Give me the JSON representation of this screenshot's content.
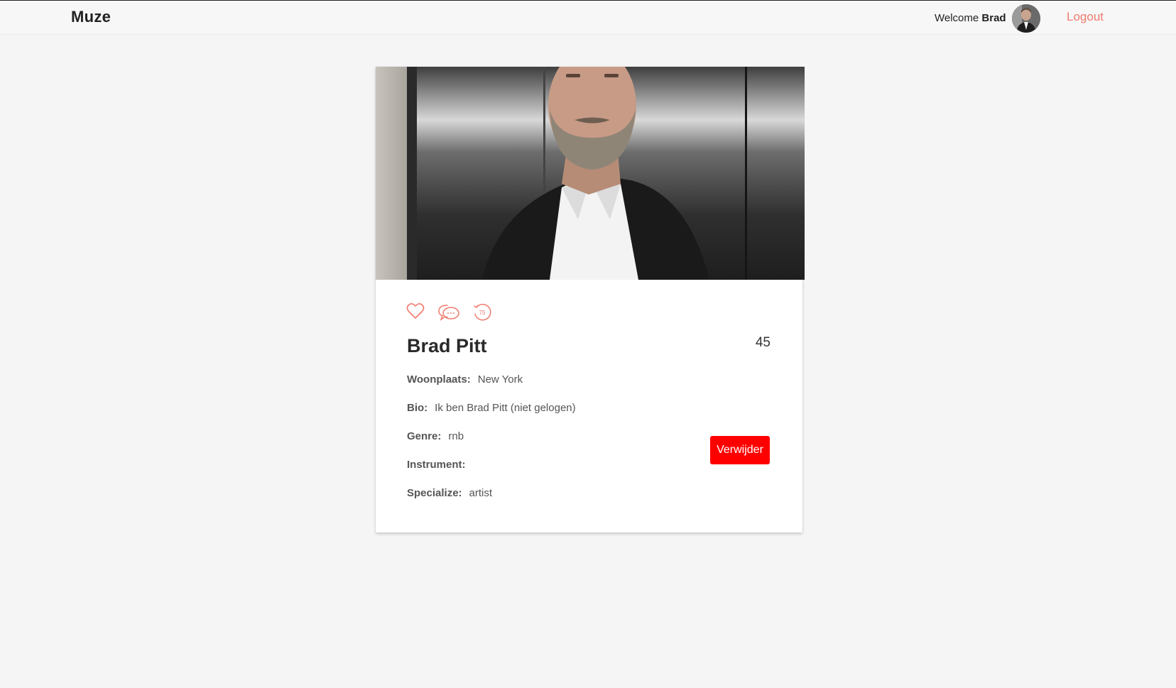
{
  "navbar": {
    "brand": "Muze",
    "welcome_prefix": "Welcome",
    "welcome_name": "Brad",
    "logout_label": "Logout"
  },
  "profile": {
    "name": "Brad Pitt",
    "age": "45",
    "fields": [
      {
        "label": "Woonplaats:",
        "value": "New York"
      },
      {
        "label": "Bio:",
        "value": "Ik ben Brad Pitt (niet gelogen)"
      },
      {
        "label": "Genre:",
        "value": "rnb"
      },
      {
        "label": "Instrument:",
        "value": ""
      },
      {
        "label": "Specialize:",
        "value": "artist"
      }
    ],
    "badge_number": "75",
    "delete_label": "Verwijder"
  },
  "colors": {
    "accent": "#f07a6e",
    "danger": "#ff0000",
    "background": "#f5f5f5"
  },
  "icons": [
    "heart-icon",
    "chat-bubble-icon",
    "rotate-badge-icon"
  ]
}
